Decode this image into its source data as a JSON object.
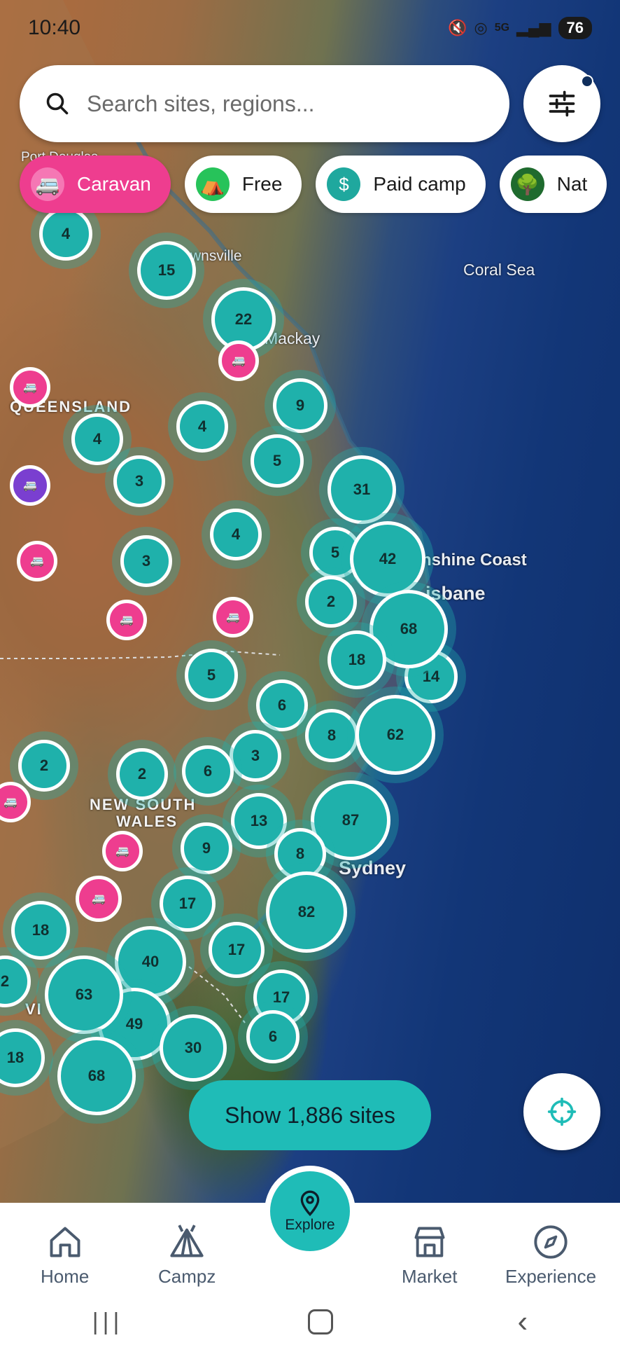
{
  "status_bar": {
    "time": "10:40",
    "network": "5G",
    "battery": "76"
  },
  "search": {
    "placeholder": "Search sites, regions..."
  },
  "filters": [
    {
      "label": "Caravan",
      "active": true,
      "icon": "caravan-icon",
      "color": "#ee3d8f"
    },
    {
      "label": "Free",
      "active": false,
      "icon": "tent-icon",
      "color": "#27c35a"
    },
    {
      "label": "Paid camp",
      "active": false,
      "icon": "dollar-icon",
      "color": "#1fa89e"
    },
    {
      "label": "Nat",
      "active": false,
      "icon": "tree-icon",
      "color": "#1f6b2e"
    }
  ],
  "map_labels": {
    "port_douglas": "Port Douglas",
    "townsville": "wnsville",
    "coral_sea": "Coral Sea",
    "mackay": "Mackay",
    "queensland": "QUEENSLAND",
    "sunshine_coast": "nshine Coast",
    "brisbane": "isbane",
    "nsw_1": "NEW SOUTH",
    "nsw_2": "WALES",
    "sydney": "Sydney",
    "vic": "VI"
  },
  "clusters": [
    "4",
    "15",
    "22",
    "9",
    "4",
    "4",
    "5",
    "3",
    "31",
    "4",
    "3",
    "5",
    "42",
    "2",
    "68",
    "18",
    "14",
    "5",
    "6",
    "8",
    "62",
    "3",
    "2",
    "2",
    "6",
    "13",
    "87",
    "9",
    "8",
    "17",
    "82",
    "18",
    "40",
    "17",
    "2",
    "63",
    "49",
    "17",
    "30",
    "6",
    "18",
    "68",
    "1"
  ],
  "show_sites": "Show 1,886 sites",
  "nav": {
    "home": "Home",
    "campz": "Campz",
    "explore": "Explore",
    "market": "Market",
    "experience": "Experience"
  },
  "colors": {
    "accent_teal": "#1fbcb7",
    "caravan_pink": "#ee3d8f"
  }
}
